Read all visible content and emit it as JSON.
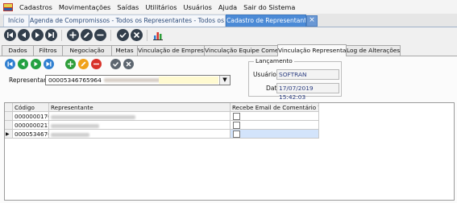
{
  "menu": {
    "items": [
      {
        "label": "Cadastros"
      },
      {
        "label": "Movimentações"
      },
      {
        "label": "Saídas"
      },
      {
        "label": "Utilitários"
      },
      {
        "label": "Usuários"
      },
      {
        "label": "Ajuda"
      },
      {
        "label": "Sair do Sistema"
      }
    ]
  },
  "doc_tabs": {
    "inicio": "Início",
    "agenda": "Agenda de Compromissos - Todos os Representantes - Todos os Clientes",
    "cadastro": "Cadastro de Representantes",
    "close": "×"
  },
  "page_tabs": {
    "dados": "Dados",
    "filtros": "Filtros",
    "negociacao": "Negociação",
    "metas": "Metas",
    "vinc_empresa": "Vinculação de Empresa",
    "vinc_equipe": "Vinculação Equipe Comercial",
    "vinc_representante": "Vinculação Representante",
    "log": "Log de Alterações"
  },
  "form": {
    "representante_label": "Representante",
    "representante_code": "00005346765964",
    "lancamento_legend": "Lançamento",
    "usuario_label": "Usuário",
    "usuario_value": "SOFTRAN",
    "data_label": "Data",
    "data_value": "17/07/2019 15:42:03",
    "dropdown_arrow": "▼"
  },
  "grid": {
    "headers": {
      "codigo": "Código",
      "representante": "Representante",
      "email": "Recebe Email de Comentário Visita"
    },
    "rows": [
      {
        "codigo": "0000000170"
      },
      {
        "codigo": "00000002176"
      },
      {
        "codigo": "000053467650"
      }
    ],
    "current_row_marker": "▶"
  },
  "colors": {
    "active_tab": "#4b8ad6",
    "toolbar_dark": "#333f4c",
    "add_green": "#2e9e3a",
    "edit_orange": "#f0a21a",
    "remove_red": "#d8332a",
    "nav_blue": "#2f7fd0",
    "nav_green": "#23a141"
  }
}
